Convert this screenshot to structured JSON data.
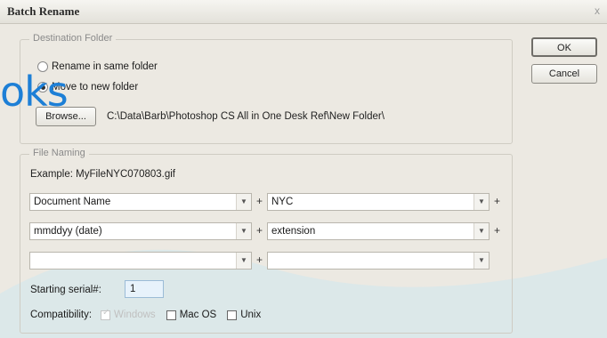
{
  "window": {
    "title": "Batch Rename",
    "close_glyph": "x"
  },
  "destination": {
    "legend": "Destination Folder",
    "option_same": "Rename in same folder",
    "option_new": "Move to new folder",
    "browse_label": "Browse...",
    "path": "C:\\Data\\Barb\\Photoshop CS All in One Desk Ref\\New Folder\\"
  },
  "buttons": {
    "ok": "OK",
    "cancel": "Cancel"
  },
  "file_naming": {
    "legend": "File Naming",
    "example": "Example: MyFileNYC070803.gif",
    "rows": [
      {
        "left": "Document Name",
        "right": "NYC"
      },
      {
        "left": "mmddyy (date)",
        "right": "extension"
      },
      {
        "left": "",
        "right": ""
      }
    ],
    "plus": "+"
  },
  "serial": {
    "label": "Starting serial#:",
    "value": "1"
  },
  "compatibility": {
    "label": "Compatibility:",
    "windows": "Windows",
    "mac": "Mac OS",
    "unix": "Unix"
  },
  "overlay": {
    "watermark_text": "oks"
  },
  "colors": {
    "accent_blue": "#1d7fd6",
    "overlay_teal": "#bfe0e8",
    "field_focus": "#e7f2fb"
  }
}
